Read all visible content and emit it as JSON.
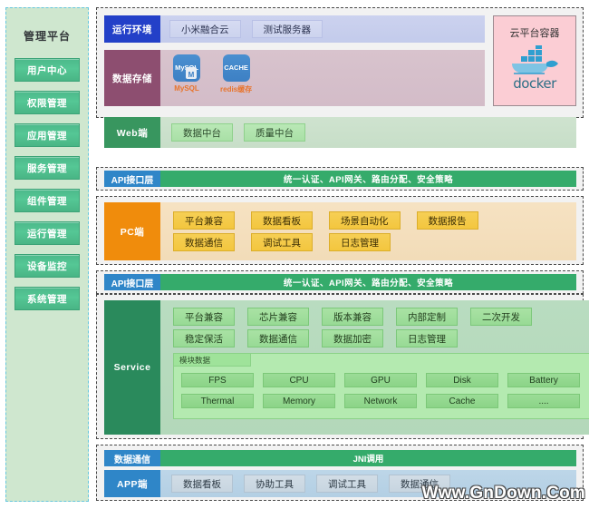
{
  "sidebar": {
    "title": "管理平台",
    "items": [
      {
        "label": "用户中心"
      },
      {
        "label": "权限管理"
      },
      {
        "label": "应用管理"
      },
      {
        "label": "服务管理"
      },
      {
        "label": "组件管理"
      },
      {
        "label": "运行管理"
      },
      {
        "label": "设备监控"
      },
      {
        "label": "系统管理"
      }
    ]
  },
  "runtime": {
    "label": "运行环境",
    "items": [
      {
        "label": "小米融合云"
      },
      {
        "label": "测试服务器"
      }
    ]
  },
  "storage": {
    "label": "数据存储",
    "items": [
      {
        "icon_text": "MySQL",
        "sub": "M",
        "caption": "MySQL"
      },
      {
        "icon_text": "CACHE",
        "sub": "",
        "caption": "redis缓存"
      }
    ]
  },
  "docker": {
    "title": "云平台容器",
    "wordmark": "docker",
    "icon": "docker-whale-icon"
  },
  "web": {
    "label": "Web端",
    "items": [
      {
        "label": "数据中台"
      },
      {
        "label": "质量中台"
      }
    ]
  },
  "api_layer_1": {
    "label": "API接口层",
    "description": "统一认证、API网关、路由分配、安全策略"
  },
  "api_layer_2": {
    "label": "API接口层",
    "description": "统一认证、API网关、路由分配、安全策略"
  },
  "pc": {
    "label": "PC端",
    "row1": [
      {
        "label": "平台兼容"
      },
      {
        "label": "数据看板"
      },
      {
        "label": "场景自动化"
      },
      {
        "label": "数据报告"
      }
    ],
    "row2": [
      {
        "label": "数据通信"
      },
      {
        "label": "调试工具"
      },
      {
        "label": "日志管理"
      }
    ]
  },
  "service": {
    "label": "Service",
    "row1": [
      {
        "label": "平台兼容"
      },
      {
        "label": "芯片兼容"
      },
      {
        "label": "版本兼容"
      },
      {
        "label": "内部定制"
      },
      {
        "label": "二次开发"
      }
    ],
    "row2": [
      {
        "label": "稳定保活"
      },
      {
        "label": "数据通信"
      },
      {
        "label": "数据加密"
      },
      {
        "label": "日志管理"
      }
    ],
    "module_panel": {
      "title": "模块数据",
      "row1": [
        {
          "label": "FPS"
        },
        {
          "label": "CPU"
        },
        {
          "label": "GPU"
        },
        {
          "label": "Disk"
        },
        {
          "label": "Battery"
        }
      ],
      "row2": [
        {
          "label": "Thermal"
        },
        {
          "label": "Memory"
        },
        {
          "label": "Network"
        },
        {
          "label": "Cache"
        },
        {
          "label": "...."
        }
      ]
    }
  },
  "jni": {
    "label": "数据通信",
    "description": "JNI调用"
  },
  "app": {
    "label": "APP端",
    "items": [
      {
        "label": "数据看板"
      },
      {
        "label": "协助工具"
      },
      {
        "label": "调试工具"
      },
      {
        "label": "数据通信"
      }
    ]
  },
  "watermark": {
    "text": "Www.GnDown.Com"
  },
  "colors": {
    "runtime_label": "#2340c8",
    "storage_label": "#8d4e70",
    "web_label": "#38965f",
    "api_label": "#2f86c8",
    "api_body": "#35ab6b",
    "pc_label": "#f08c0c",
    "service_label": "#2a8a5c",
    "app_label": "#2f86c8",
    "docker_bg": "#fbcdd4",
    "sidebar_bg": "#cfe7cf"
  }
}
